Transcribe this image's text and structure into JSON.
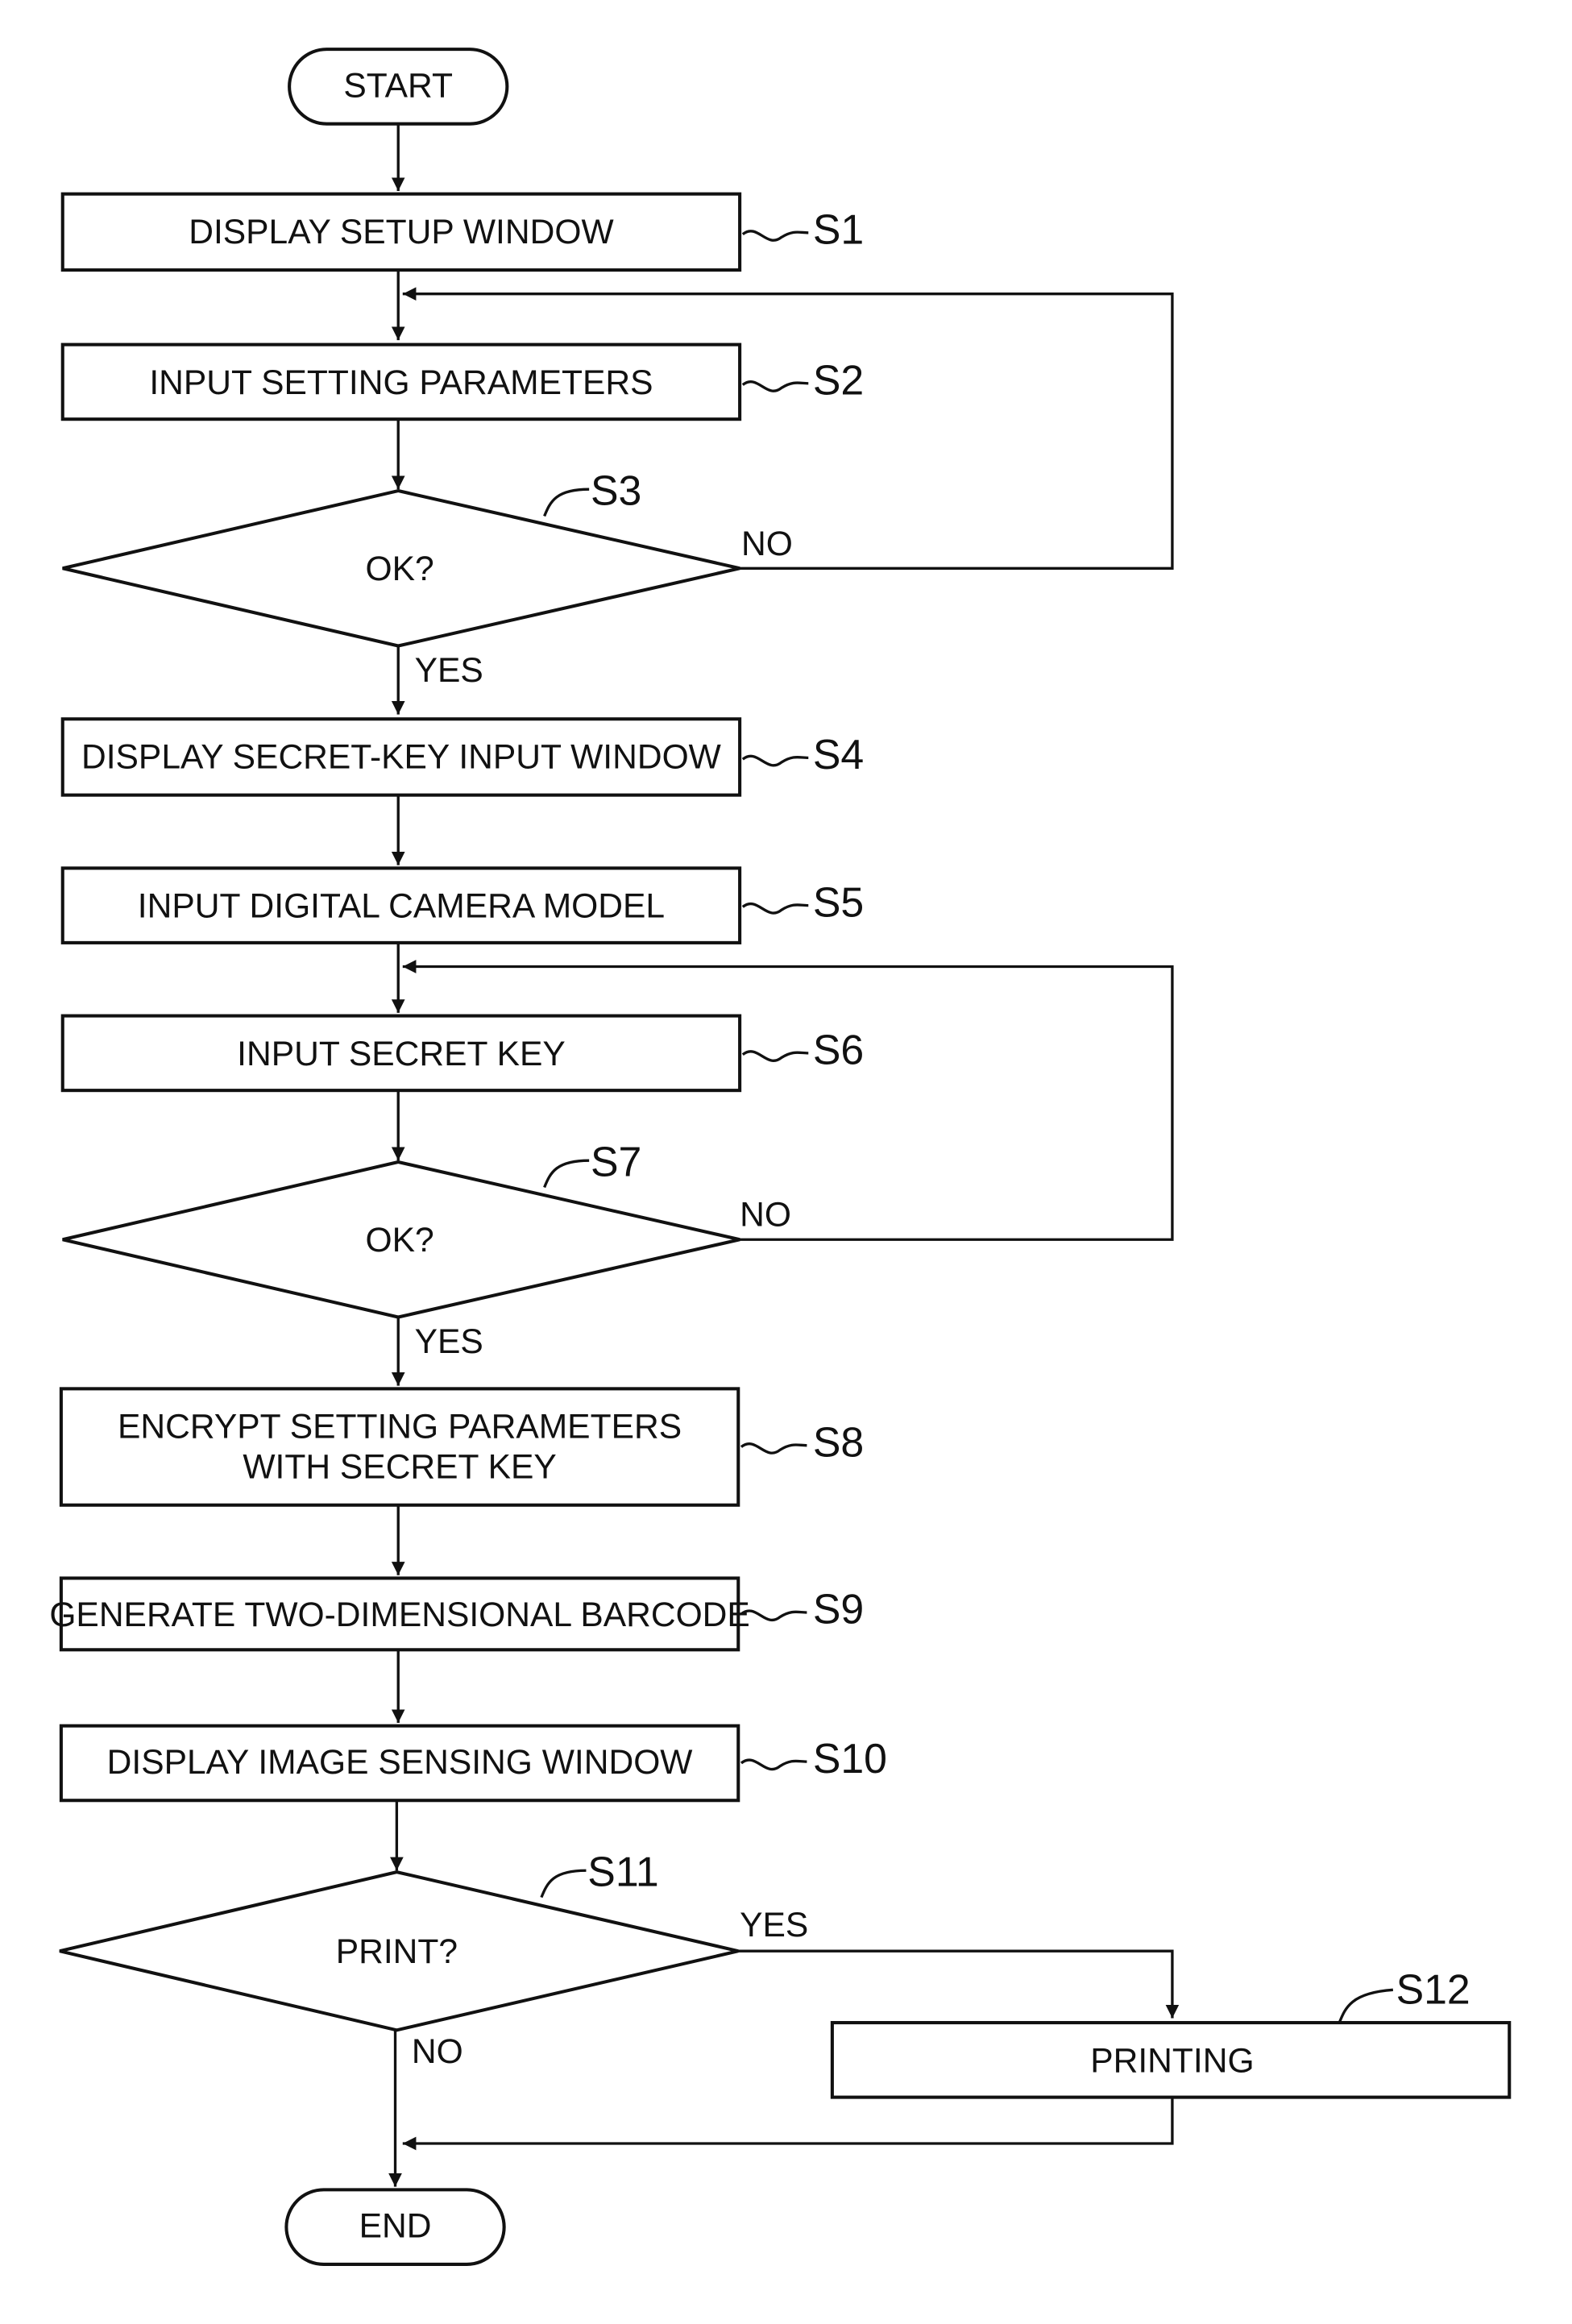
{
  "diagram": {
    "type": "flowchart",
    "start": "START",
    "end": "END",
    "steps": [
      {
        "id": "S1",
        "label": "DISPLAY SETUP WINDOW",
        "kind": "process"
      },
      {
        "id": "S2",
        "label": "INPUT SETTING PARAMETERS",
        "kind": "process"
      },
      {
        "id": "S3",
        "label": "OK?",
        "kind": "decision"
      },
      {
        "id": "S4",
        "label": "DISPLAY SECRET-KEY INPUT WINDOW",
        "kind": "process"
      },
      {
        "id": "S5",
        "label": "INPUT DIGITAL CAMERA MODEL",
        "kind": "process"
      },
      {
        "id": "S6",
        "label": "INPUT SECRET KEY",
        "kind": "process"
      },
      {
        "id": "S7",
        "label": "OK?",
        "kind": "decision"
      },
      {
        "id": "S8",
        "label_line1": "ENCRYPT SETTING PARAMETERS",
        "label_line2": "WITH SECRET KEY",
        "kind": "process"
      },
      {
        "id": "S9",
        "label": "GENERATE TWO-DIMENSIONAL BARCODE",
        "kind": "process"
      },
      {
        "id": "S10",
        "label": "DISPLAY IMAGE SENSING WINDOW",
        "kind": "process"
      },
      {
        "id": "S11",
        "label": "PRINT?",
        "kind": "decision"
      },
      {
        "id": "S12",
        "label": "PRINTING",
        "kind": "process"
      }
    ],
    "branches": {
      "s3_no": "NO",
      "s3_yes": "YES",
      "s7_no": "NO",
      "s7_yes": "YES",
      "s11_yes": "YES",
      "s11_no": "NO"
    }
  }
}
